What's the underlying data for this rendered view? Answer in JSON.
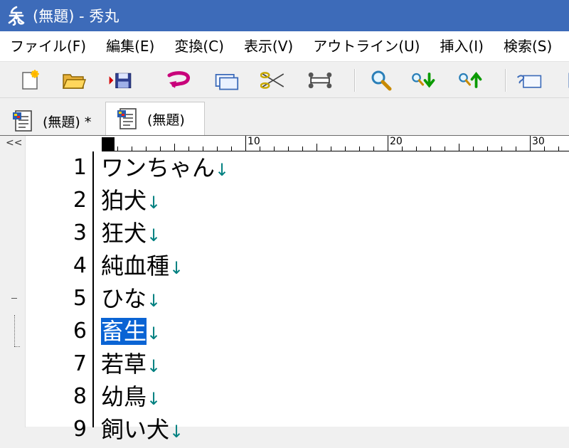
{
  "window": {
    "title": "(無題) - 秀丸"
  },
  "menu": [
    {
      "label": "ファイル(F)"
    },
    {
      "label": "編集(E)"
    },
    {
      "label": "変換(C)"
    },
    {
      "label": "表示(V)"
    },
    {
      "label": "アウトライン(U)"
    },
    {
      "label": "挿入(I)"
    },
    {
      "label": "検索(S)"
    }
  ],
  "toolbar": {
    "buttons": [
      "new-file-icon",
      "open-folder-icon",
      "save-icon",
      "undo-icon",
      "copy-window-icon",
      "cut-icon",
      "paste-icon",
      "find-icon",
      "find-down-icon",
      "find-up-icon",
      "tag-window-icon",
      "grid-icon"
    ]
  },
  "tabs": [
    {
      "label": "(無題) *",
      "active": false
    },
    {
      "label": "(無題)",
      "active": true
    }
  ],
  "editor": {
    "collapse_label": "<<",
    "ruler_marks": [
      "10",
      "20",
      "30"
    ],
    "newline_mark": "↓",
    "lines": [
      {
        "num": "1",
        "text": "ワンちゃん",
        "selected": false
      },
      {
        "num": "2",
        "text": "狛犬",
        "selected": false
      },
      {
        "num": "3",
        "text": "狂犬",
        "selected": false
      },
      {
        "num": "4",
        "text": "純血種",
        "selected": false
      },
      {
        "num": "5",
        "text": "ひな",
        "selected": false
      },
      {
        "num": "6",
        "text": "畜生",
        "selected": true
      },
      {
        "num": "7",
        "text": "若草",
        "selected": false
      },
      {
        "num": "8",
        "text": "幼鳥",
        "selected": false
      },
      {
        "num": "9",
        "text": "飼い犬",
        "selected": false
      }
    ]
  }
}
